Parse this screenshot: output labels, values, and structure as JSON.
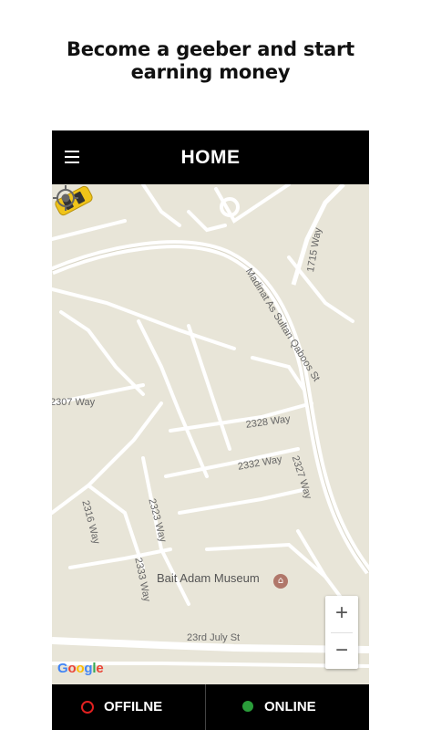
{
  "promo": {
    "line1": "Become a geeber and start",
    "line2": "earning money"
  },
  "app": {
    "title": "HOME",
    "menu_icon": "hamburger-menu-icon"
  },
  "map": {
    "streets": {
      "madinat": "Madinat As Sultan Qaboos St",
      "w1715": "1715 Way",
      "w2307": "2307 Way",
      "w2328": "2328 Way",
      "w2332": "2332 Way",
      "w2327": "2327 Way",
      "w2316": "2316 Way",
      "w2323": "2323 Way",
      "w2333": "2333 Way",
      "july": "23rd July St"
    },
    "poi": "Bait Adam Museum",
    "google": "Google",
    "zoom_in": "+",
    "zoom_out": "−",
    "locate_icon": "my-location-icon",
    "colors": {
      "land": "#e8e5d8",
      "road": "#ffffff",
      "taxi": "#f0c419"
    }
  },
  "status": {
    "offline_label": "OFFILNE",
    "online_label": "ONLINE",
    "offline_color": "#e02020",
    "online_color": "#2a9d3a"
  }
}
